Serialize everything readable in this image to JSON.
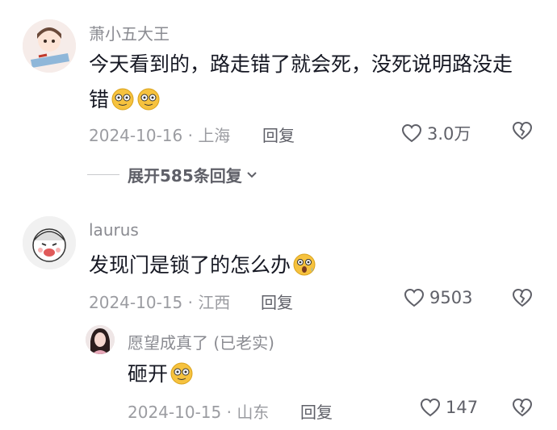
{
  "comments": [
    {
      "username": "萧小五大王",
      "text": "今天看到的，路走错了就会死，没死说明路没走错",
      "date": "2024-10-16",
      "location": "上海",
      "reply_label": "回复",
      "likes": "3.0万",
      "expand_label": "展开585条回复"
    },
    {
      "username": "laurus",
      "text": "发现门是锁了的怎么办",
      "date": "2024-10-15",
      "location": "江西",
      "reply_label": "回复",
      "likes": "9503",
      "reply": {
        "username": "愿望成真了 (已老实)",
        "text": "砸开",
        "date": "2024-10-15",
        "location": "山东",
        "reply_label": "回复",
        "likes": "147"
      }
    }
  ],
  "icons": {
    "like": "heart-outline-icon",
    "dislike": "broken-heart-icon",
    "expand": "chevron-down-icon"
  },
  "colors": {
    "text": "#161823",
    "meta": "#9b9ca1",
    "action": "#5f6068",
    "emoji": "#f6c23e"
  }
}
